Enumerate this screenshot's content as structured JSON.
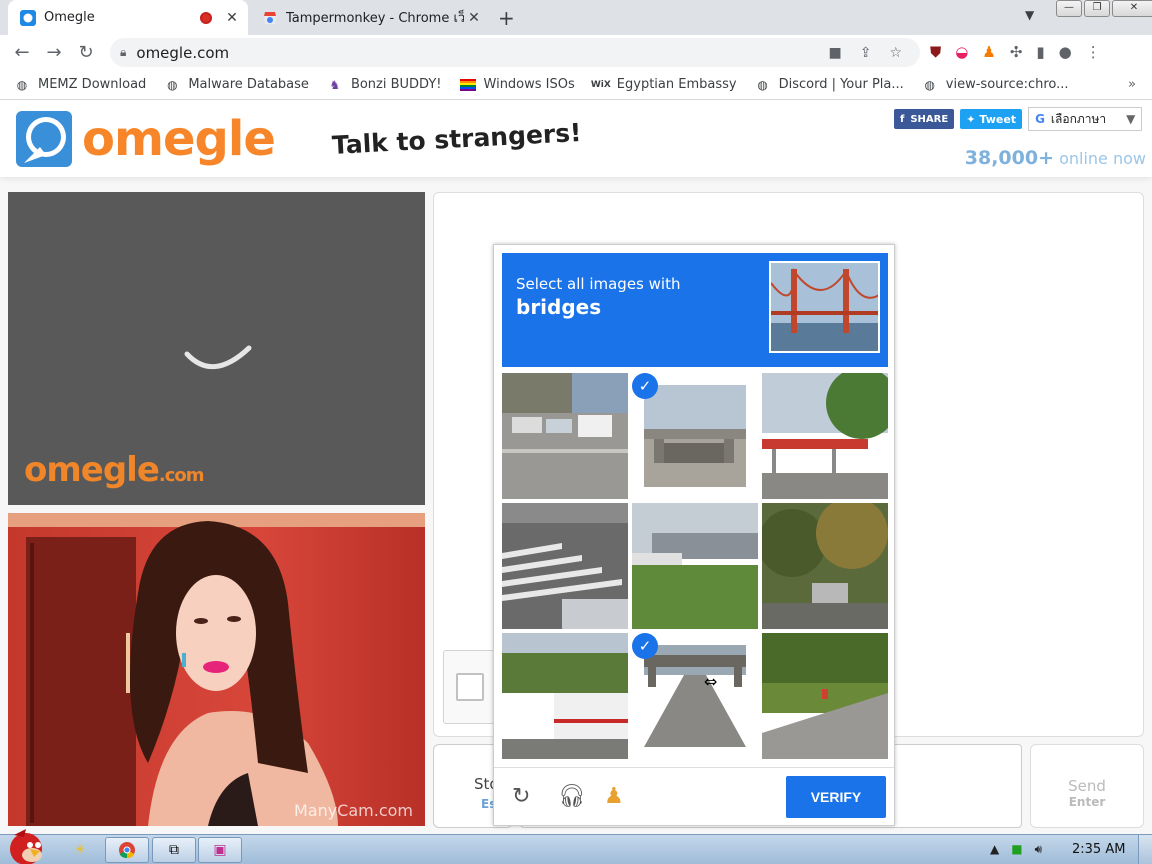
{
  "browser": {
    "tabs": [
      {
        "title": "Omegle",
        "active": true
      },
      {
        "title": "Tampermonkey - Chrome เว็บส",
        "active": false
      }
    ],
    "url": "omegle.com",
    "window_buttons": [
      "—",
      "❐",
      "✕"
    ]
  },
  "bookmarks": [
    {
      "label": "MEMZ Download",
      "icon": "globe-icon"
    },
    {
      "label": "Malware Database",
      "icon": "globe-icon"
    },
    {
      "label": "Bonzi BUDDY!",
      "icon": "bonzi-icon"
    },
    {
      "label": "Windows ISOs",
      "icon": "rainbow-flag-icon"
    },
    {
      "label": "Egyptian Embassy",
      "icon": "wix-icon"
    },
    {
      "label": "Discord | Your Pla...",
      "icon": "globe-icon"
    },
    {
      "label": "view-source:chro...",
      "icon": "globe-icon"
    }
  ],
  "bookmarks_more": "»",
  "site": {
    "logo_text": "omegle",
    "tagline": "Talk to strangers!",
    "share_fb": "SHARE",
    "share_tw": "Tweet",
    "translate_label": "เลือกภาษา",
    "online_count": "38,000+",
    "online_suffix": "online now",
    "video_watermark": "omegle",
    "video_watermark_suffix": ".com",
    "webcam_watermark": "ManyCam.com"
  },
  "chat": {
    "stop_label": "Sto",
    "stop_key": "Es",
    "send_label": "Send",
    "send_key": "Enter"
  },
  "captcha": {
    "prompt_line1": "Select all images with",
    "prompt_target": "bridges",
    "tiles": [
      {
        "scene": "parking-lot",
        "selected": false
      },
      {
        "scene": "highway-overpass",
        "selected": true
      },
      {
        "scene": "gas-station",
        "selected": false
      },
      {
        "scene": "crosswalk",
        "selected": false
      },
      {
        "scene": "highway-truck",
        "selected": false
      },
      {
        "scene": "trees-street",
        "selected": false
      },
      {
        "scene": "bus-street",
        "selected": false
      },
      {
        "scene": "road-overpass",
        "selected": true
      },
      {
        "scene": "curb-sidewalk",
        "selected": false
      }
    ],
    "verify_label": "VERIFY"
  },
  "taskbar": {
    "clock": "2:35 AM"
  }
}
